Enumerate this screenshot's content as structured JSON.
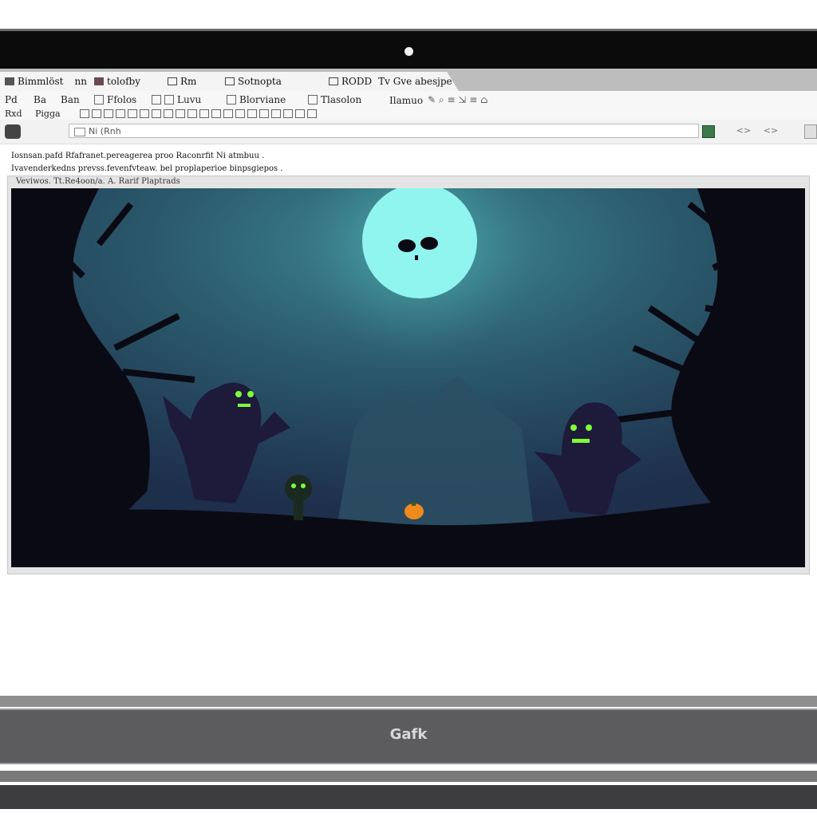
{
  "tabs": [
    {
      "label": "Bimmlöst",
      "extra": "nn"
    },
    {
      "label": "tolofby"
    },
    {
      "label": "Rm"
    },
    {
      "label": "Sotnopta"
    },
    {
      "label": "RODD",
      "extra": "Tv Gve abesjpe"
    }
  ],
  "menu": {
    "row1": [
      "Pd",
      "Ba",
      "Ban",
      "Ffolos",
      "Luvu",
      "Blorviane",
      "Tlasolon",
      "Ilamuo"
    ],
    "row2": [
      "Rxd",
      "Pigga"
    ]
  },
  "address": {
    "url": "Ni (Rnh",
    "nav_icons": [
      "<>",
      "<>"
    ]
  },
  "page": {
    "line1": "Iosnsan.pafd Rfafranet.pereagerea proo Raconrfit Ni atmbuu .",
    "line2": "Ivavenderkedns prevss.fevenfvteaw. bel proplaperioe binpsgiepos .",
    "frame_caption": "Veviwos. Tt.Re4oon/a. A. Rarif Plaptrads"
  },
  "game": {
    "scene": "pixel-art haunted forest night scene",
    "colors": {
      "sky": "#35697a",
      "moon": "#8ff5ee",
      "ground": "#0a0a14",
      "eyes": "#7dff3a",
      "pumpkin": "#f08a1c"
    }
  },
  "laptop": {
    "brand": "Gafk"
  }
}
